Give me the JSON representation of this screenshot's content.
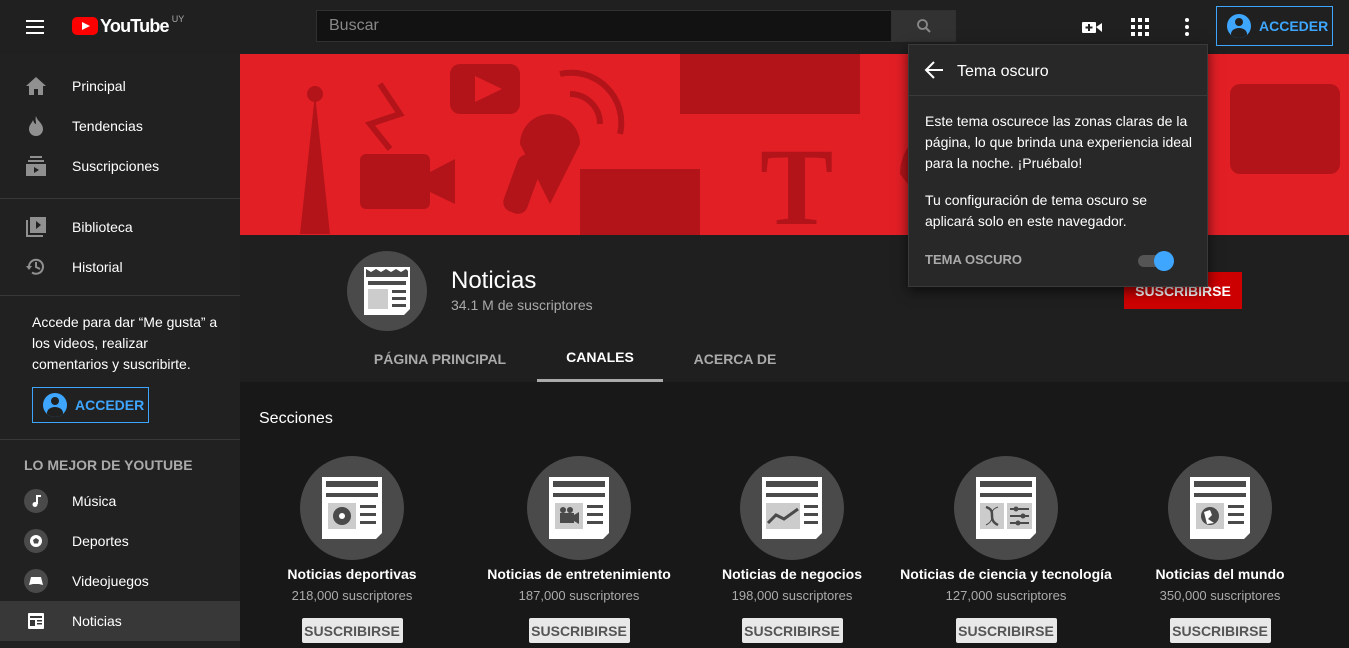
{
  "topbar": {
    "logo_text": "YouTube",
    "country_code": "UY",
    "search_placeholder": "Buscar",
    "signin_label": "ACCEDER"
  },
  "sidebar": {
    "items": [
      {
        "label": "Principal",
        "icon": "home-icon"
      },
      {
        "label": "Tendencias",
        "icon": "flame-icon"
      },
      {
        "label": "Suscripciones",
        "icon": "subscriptions-icon"
      },
      {
        "label": "Biblioteca",
        "icon": "library-icon"
      },
      {
        "label": "Historial",
        "icon": "history-icon"
      }
    ],
    "signin_prompt": "Accede para dar “Me gusta” a los videos, realizar comentarios y suscribirte.",
    "signin_label": "ACCEDER",
    "best_header": "LO MEJOR DE YOUTUBE",
    "best_items": [
      {
        "label": "Música",
        "icon": "music-icon"
      },
      {
        "label": "Deportes",
        "icon": "sports-icon"
      },
      {
        "label": "Videojuegos",
        "icon": "gaming-icon"
      },
      {
        "label": "Noticias",
        "icon": "news-icon",
        "active": true
      }
    ]
  },
  "channel": {
    "name": "Noticias",
    "subscribers": "34.1 M de suscriptores",
    "subscribe_label": "SUSCRIBIRSE",
    "tabs": [
      {
        "label": "PÁGINA PRINCIPAL"
      },
      {
        "label": "CANALES",
        "active": true
      },
      {
        "label": "ACERCA DE"
      }
    ]
  },
  "sections": {
    "title": "Secciones",
    "cards": [
      {
        "name": "Noticias deportivas",
        "subs": "218,000 suscriptores",
        "button": "SUSCRIBIRSE",
        "icon": "sports-news-icon"
      },
      {
        "name": "Noticias de entretenimiento",
        "subs": "187,000 suscriptores",
        "button": "SUSCRIBIRSE",
        "icon": "entertainment-news-icon"
      },
      {
        "name": "Noticias de negocios",
        "subs": "198,000 suscriptores",
        "button": "SUSCRIBIRSE",
        "icon": "business-news-icon"
      },
      {
        "name": "Noticias de ciencia y tecnología",
        "subs": "127,000 suscriptores",
        "button": "SUSCRIBIRSE",
        "icon": "science-news-icon"
      },
      {
        "name": "Noticias del mundo",
        "subs": "350,000 suscriptores",
        "button": "SUSCRIBIRSE",
        "icon": "world-news-icon"
      }
    ]
  },
  "dark_theme_popup": {
    "title": "Tema oscuro",
    "paragraph1": "Este tema oscurece las zonas claras de la página, lo que brinda una experiencia ideal para la noche. ¡Pruébalo!",
    "paragraph2": "Tu configuración de tema oscuro se aplicará solo en este navegador.",
    "toggle_label": "TEMA OSCURO",
    "toggle_on": true
  },
  "colors": {
    "accent": "#3ea6ff",
    "banner": "#e31f26",
    "subscribe": "#cc0000",
    "background": "#181818"
  }
}
